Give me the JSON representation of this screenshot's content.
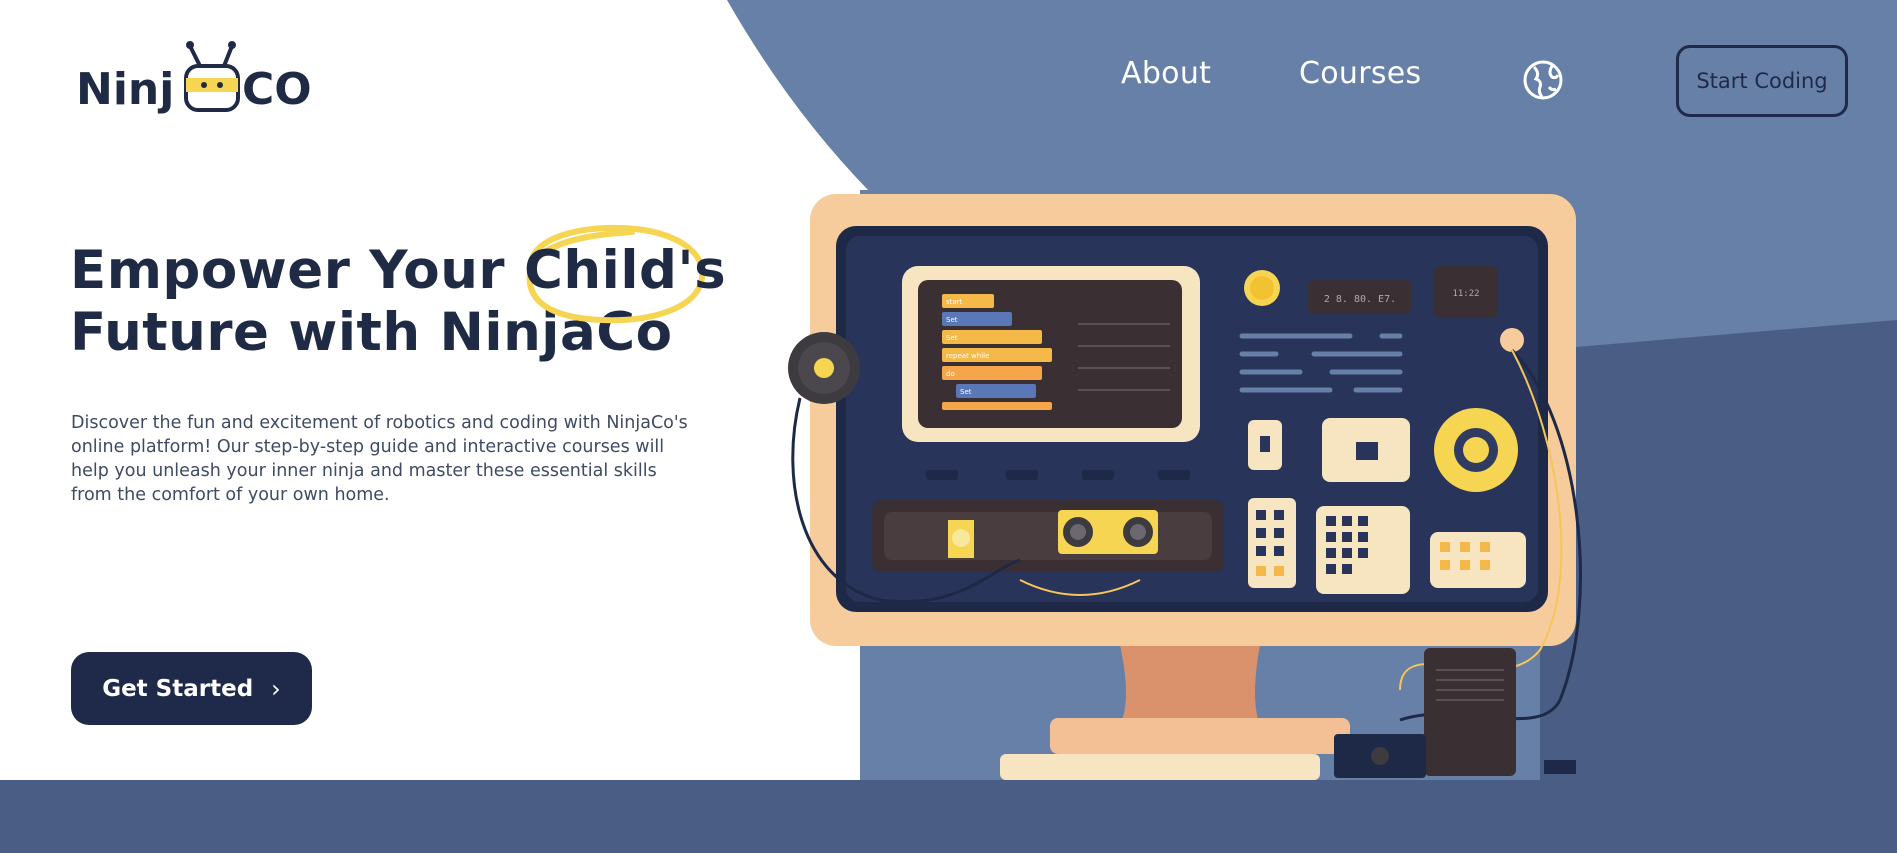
{
  "brand": {
    "name_left": "Ninj",
    "name_right": "CO"
  },
  "nav": {
    "about": "About",
    "courses": "Courses",
    "language_icon": "globe-icon"
  },
  "cta": {
    "start_coding": "Start Coding",
    "get_started": "Get Started",
    "get_started_icon": "chevron-right-icon"
  },
  "hero": {
    "headline_part1": "Empower Your ",
    "headline_highlight": "Child's",
    "headline_line2": "Future with NinjaCo",
    "description": "Discover the fun and excitement of robotics and coding with NinjaCo's online platform! Our step-by-step guide and interactive courses will help you unleash your inner ninja and master these essential skills from the comfort of your own home."
  },
  "illustration": {
    "display_left": "2 8. 80. E7.",
    "display_right": "11:22",
    "block_labels": [
      "start",
      "Set",
      "Set",
      "repeat while",
      "do",
      "Set"
    ]
  },
  "colors": {
    "navy": "#1f2a4a",
    "accent_yellow": "#f5d552",
    "blue_bg": "#6780a8",
    "dark_blue_band": "#4a5e85",
    "peach": "#f6cc9c"
  }
}
